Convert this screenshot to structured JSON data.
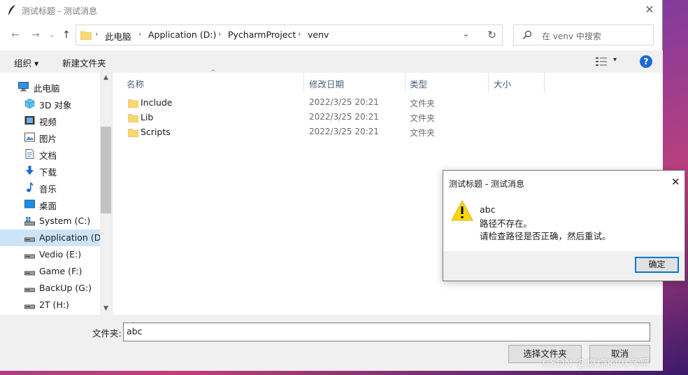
{
  "window": {
    "title": "测试标题 - 测试消息",
    "close_glyph": "✕"
  },
  "navbar": {
    "back_glyph": "←",
    "forward_glyph": "→",
    "recent_glyph": "⌄",
    "up_glyph": "↑",
    "breadcrumbs": [
      "此电脑",
      "Application (D:)",
      "PycharmProject",
      "venv"
    ],
    "separator": "›",
    "dropdown_glyph": "⌄",
    "refresh_glyph": "↻",
    "search_placeholder": "在 venv 中搜索"
  },
  "toolbar": {
    "organize_label": "组织 ▾",
    "new_folder_label": "新建文件夹",
    "view_arrow": "▾",
    "help_label": "?"
  },
  "sidebar": {
    "items": [
      {
        "label": "此电脑",
        "icon": "computer-icon"
      },
      {
        "label": "3D 对象",
        "icon": "cube-3d-icon"
      },
      {
        "label": "视频",
        "icon": "video-icon"
      },
      {
        "label": "图片",
        "icon": "picture-icon"
      },
      {
        "label": "文档",
        "icon": "document-icon"
      },
      {
        "label": "下载",
        "icon": "download-icon"
      },
      {
        "label": "音乐",
        "icon": "music-icon"
      },
      {
        "label": "桌面",
        "icon": "desktop-icon"
      },
      {
        "label": "System (C:)",
        "icon": "system-drive-icon"
      },
      {
        "label": "Application (D:)",
        "icon": "drive-icon"
      },
      {
        "label": "Vedio (E:)",
        "icon": "drive-icon"
      },
      {
        "label": "Game (F:)",
        "icon": "drive-icon"
      },
      {
        "label": "BackUp (G:)",
        "icon": "drive-icon"
      },
      {
        "label": "2T (H:)",
        "icon": "drive-icon"
      }
    ],
    "selected_index": 9
  },
  "file_list": {
    "columns": [
      "名称",
      "修改日期",
      "类型",
      "大小"
    ],
    "rows": [
      {
        "name": "Include",
        "date": "2022/3/25 20:21",
        "type": "文件夹"
      },
      {
        "name": "Lib",
        "date": "2022/3/25 20:21",
        "type": "文件夹"
      },
      {
        "name": "Scripts",
        "date": "2022/3/25 20:21",
        "type": "文件夹"
      }
    ]
  },
  "bottom": {
    "folder_label": "文件夹:",
    "folder_value": "abc",
    "select_button": "选择文件夹",
    "cancel_button": "取消"
  },
  "dialog": {
    "title": "测试标题 - 测试消息",
    "close_glyph": "✕",
    "message_lines": [
      "abc",
      "路径不存在。",
      "请检查路径是否正确，然后重试。"
    ],
    "ok_button": "确定"
  },
  "watermark": "CSDN @燃烧的火鸟啊",
  "colors": {
    "accent": "#0078d7",
    "folder": "#f8d775",
    "selection": "#cce4f7",
    "help": "#1c6ad3",
    "warning": "#ffd800"
  }
}
